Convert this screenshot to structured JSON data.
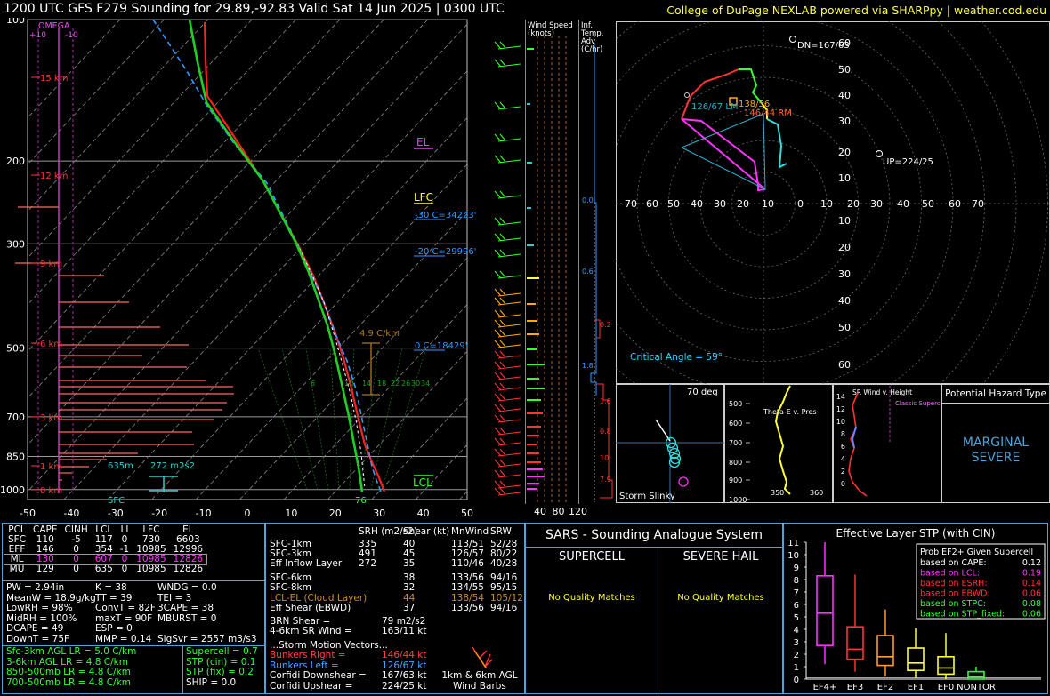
{
  "header": {
    "title": "1200 UTC GFS F279 Sounding for 29.89,-92.83 Valid  Sat 14 Jun 2025 | 0300 UTC",
    "credit": "College of DuPage NEXLAB powered via SHARPpy | weather.cod.edu"
  },
  "skewt": {
    "pressure_ticks": [
      "100",
      "200",
      "300",
      "500",
      "700",
      "850",
      "1000"
    ],
    "temp_ticks": [
      "-50",
      "-40",
      "-30",
      "-20",
      "-10",
      "0",
      "10",
      "20",
      "30",
      "40",
      "50"
    ],
    "omega_label": "OMEGA",
    "omega_ticks": [
      "+10",
      "-10"
    ],
    "height_labels": [
      "15 km",
      "12 km",
      "9 km",
      "6 km",
      "3 km",
      "1 km",
      "0 km"
    ],
    "el_label": "EL",
    "lfc_label": "LFC",
    "lcl_label": "LCL",
    "sfc_label": "SFC",
    "dcape_label": "76",
    "srh_label": "272 m2s2",
    "depth_label": "635m",
    "iso_labels": [
      "-30 C=34223'",
      "-20 C=29996'",
      "0 C=18429'"
    ],
    "lapse_label": "4.9 C/km",
    "mixing_labels": [
      "6",
      "10",
      "14",
      "18",
      "22",
      "26",
      "30",
      "34"
    ]
  },
  "wind_speed": {
    "title": "Wind Speed (knots)",
    "ticks": [
      "40",
      "80",
      "120"
    ]
  },
  "temp_adv": {
    "title": "Inf. Temp. Adv (C/hr)",
    "values": [
      "0.0",
      "0.6",
      "1.8",
      "0.2",
      "1.6",
      "0.8",
      "10.",
      "7.9"
    ]
  },
  "hodograph": {
    "rings": [
      "10",
      "20",
      "30",
      "40",
      "50",
      "60"
    ],
    "axis_x": [
      "70",
      "60",
      "50",
      "40",
      "30",
      "20",
      "10",
      "0",
      "10",
      "20",
      "30",
      "40",
      "50",
      "60",
      "70"
    ],
    "labels": {
      "dn": "DN=167/63",
      "up": "UP=224/25",
      "lm": "126/67 LM",
      "rm": "146/44 RM",
      "mean": "138/56",
      "critical": "Critical Angle = 59°"
    }
  },
  "storm_slinky": {
    "title": "Storm Slinky",
    "angle": "70 deg"
  },
  "theta_e": {
    "title": "Theta-E v. Pres",
    "yticks": [
      "500",
      "600",
      "700",
      "800",
      "900",
      "1000"
    ],
    "xticks": [
      "350",
      "360"
    ]
  },
  "sr_wind": {
    "title": "SR Wind v. Height",
    "yticks": [
      "14",
      "12",
      "10",
      "8",
      "6",
      "4",
      "2",
      "0"
    ],
    "classic": "Classic Supercell"
  },
  "hazard": {
    "title": "Potential Hazard Type",
    "value_line1": "MARGINAL",
    "value_line2": "SEVERE"
  },
  "parcels": {
    "headers": [
      "PCL",
      "CAPE",
      "CINH",
      "LCL",
      "LI",
      "LFC",
      "EL"
    ],
    "rows": [
      [
        "SFC",
        "110",
        "-5",
        "117",
        "0",
        "730",
        "6603"
      ],
      [
        "EFF",
        "146",
        "0",
        "354",
        "-1",
        "10985",
        "12996"
      ],
      [
        "ML",
        "130",
        "0",
        "607",
        "0",
        "10985",
        "12826"
      ],
      [
        "MU",
        "129",
        "0",
        "635",
        "0",
        "10985",
        "12826"
      ]
    ]
  },
  "indices": [
    [
      "PW = 2.94in",
      "K = 38",
      "WNDG = 0.0"
    ],
    [
      "MeanW = 18.9g/kg",
      "TT = 39",
      "TEI = 3"
    ],
    [
      "LowRH = 98%",
      "ConvT = 82F",
      "3CAPE = 38"
    ],
    [
      "MidRH = 100%",
      "maxT = 90F",
      "MBURST = 0"
    ],
    [
      "DCAPE = 49",
      "ESP = 0",
      ""
    ],
    [
      "DownT = 75F",
      "MMP = 0.14",
      "SigSvr = 2557 m3/s3"
    ]
  ],
  "lapse_rates": [
    "Sfc-3km AGL LR = 5.0 C/km",
    "3-6km AGL LR = 4.8 C/km",
    "850-500mb LR = 4.8 C/km",
    "700-500mb LR = 4.8 C/km"
  ],
  "composite": [
    "Supercell = 0.7",
    "STP (cin) = 0.1",
    "STP (fix) = 0.2",
    "SHIP = 0.0"
  ],
  "kinematics": {
    "headers": [
      "",
      "SRH (m2/s2)",
      "Shear (kt)",
      "MnWind",
      "SRW"
    ],
    "rows": [
      [
        "SFC-1km",
        "335",
        "40",
        "113/51",
        "52/28"
      ],
      [
        "SFC-3km",
        "491",
        "45",
        "126/57",
        "80/22"
      ],
      [
        "Eff Inflow Layer",
        "272",
        "35",
        "110/46",
        "40/28"
      ],
      [
        "SFC-6km",
        "",
        "38",
        "133/56",
        "94/16"
      ],
      [
        "SFC-8km",
        "",
        "32",
        "134/55",
        "95/15"
      ],
      [
        "LCL-EL (Cloud Layer)",
        "",
        "44",
        "138/54",
        "105/12"
      ],
      [
        "Eff Shear (EBWD)",
        "",
        "37",
        "133/56",
        "94/16"
      ]
    ],
    "brn_label": "BRN Shear =",
    "brn_value": "79 m2/s2",
    "sr46_label": "4-6km SR Wind =",
    "sr46_value": "163/11 kt",
    "storm_title": "...Storm Motion Vectors...",
    "storm": [
      [
        "Bunkers Right =",
        "146/44 kt"
      ],
      [
        "Bunkers Left =",
        "126/67 kt"
      ],
      [
        "Corfidi Downshear =",
        "167/63 kt"
      ],
      [
        "Corfidi Upshear =",
        "224/25 kt"
      ]
    ],
    "barbs_caption_1": "1km & 6km AGL",
    "barbs_caption_2": "Wind Barbs"
  },
  "sars": {
    "title": "SARS - Sounding Analogue System",
    "supercell": "SUPERCELL",
    "hail": "SEVERE HAIL",
    "no_match_1": "No Quality Matches",
    "no_match_2": "No Quality Matches"
  },
  "stp": {
    "title": "Effective Layer STP (with CIN)",
    "legend_title": "Prob EF2+ Given Supercell",
    "legend": [
      {
        "label": "based on CAPE:",
        "value": "0.12",
        "color": "#ffffff"
      },
      {
        "label": "based on LCL:",
        "value": "0.19",
        "color": "#ff33ff"
      },
      {
        "label": "based on ESRH:",
        "value": "0.14",
        "color": "#ff3333"
      },
      {
        "label": "based on EBWD:",
        "value": "0.06",
        "color": "#ff3333"
      },
      {
        "label": "based on STPC:",
        "value": "0.08",
        "color": "#33ff33"
      },
      {
        "label": "based on STP_fixed:",
        "value": "0.06",
        "color": "#33ff33"
      }
    ],
    "yticks": [
      "0",
      "1",
      "2",
      "3",
      "4",
      "5",
      "6",
      "7",
      "8",
      "9",
      "10",
      "11"
    ],
    "categories": [
      "EF4+",
      "EF3",
      "EF2",
      "EF1",
      "EF0",
      "NONTOR"
    ]
  },
  "chart_data": {
    "type": "box",
    "title": "Effective Layer STP (with CIN)",
    "categories": [
      "EF4+",
      "EF3",
      "EF2",
      "EF1",
      "EF0",
      "NONTOR"
    ],
    "ylim": [
      0,
      11
    ],
    "boxes": [
      {
        "name": "EF4+",
        "whisker_low": 1.2,
        "q1": 2.7,
        "median": 5.3,
        "q3": 8.3,
        "whisker_high": 11.0,
        "color": "#ff33ff"
      },
      {
        "name": "EF3",
        "whisker_low": 0.6,
        "q1": 1.6,
        "median": 2.4,
        "q3": 4.2,
        "whisker_high": 8.4,
        "color": "#ff3333"
      },
      {
        "name": "EF2",
        "whisker_low": 0.2,
        "q1": 1.1,
        "median": 1.8,
        "q3": 3.5,
        "whisker_high": 5.6,
        "color": "#ff9933"
      },
      {
        "name": "EF1",
        "whisker_low": 0.1,
        "q1": 0.7,
        "median": 1.3,
        "q3": 2.5,
        "whisker_high": 4.1,
        "color": "#ffff33"
      },
      {
        "name": "EF0",
        "whisker_low": 0.0,
        "q1": 0.4,
        "median": 0.9,
        "q3": 1.8,
        "whisker_high": 3.7,
        "color": "#ffff33"
      },
      {
        "name": "NONTOR",
        "whisker_low": 0.0,
        "q1": 0.0,
        "median": 0.2,
        "q3": 0.6,
        "whisker_high": 1.0,
        "color": "#33ff33"
      }
    ],
    "current_value": 0.1
  },
  "colors": {
    "panel_border": "#4fa3d9",
    "temp": "#ff2020",
    "dewpoint": "#20d020",
    "wetbulb": "#40a0ff",
    "accent_yellow": "#ffff00"
  }
}
